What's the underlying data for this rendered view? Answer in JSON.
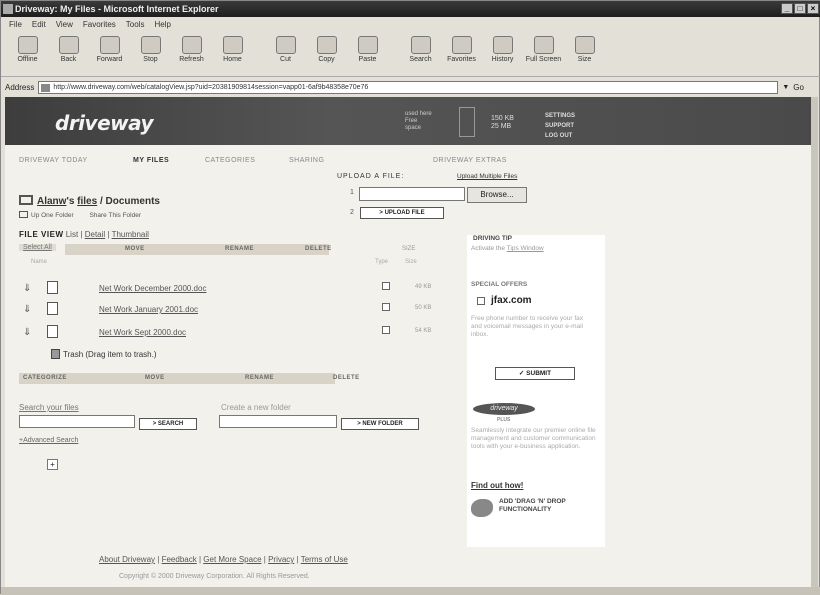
{
  "browser": {
    "title": "Driveway: My Files - Microsoft Internet Explorer",
    "menu": [
      "File",
      "Edit",
      "View",
      "Favorites",
      "Tools",
      "Help"
    ],
    "toolbar": [
      "Offline",
      "Back",
      "Forward",
      "Stop",
      "Refresh",
      "Home",
      "Cut",
      "Copy",
      "Paste",
      "Search",
      "Favorites",
      "History",
      "Full Screen",
      "Size"
    ],
    "address_label": "Address",
    "address_url": "http://www.driveway.com/web/catalogView.jsp?uid=20381909814session=vapp01-6af9b48358e70e76",
    "links_label": "Links",
    "go_label": "Go"
  },
  "header": {
    "logo": "driveway",
    "storage_lines": [
      "used here",
      "Free",
      "space"
    ],
    "used_lines": [
      "150 KB",
      "25 MB"
    ],
    "links": [
      "SETTINGS",
      "SUPPORT",
      "LOG OUT"
    ]
  },
  "nav": {
    "tabs": [
      "DRIVEWAY TODAY",
      "MY FILES",
      "CATEGORIES",
      "SHARING",
      "DRIVEWAY EXTRAS"
    ]
  },
  "upload": {
    "label": "UPLOAD A FILE:",
    "multi_link": "Upload Multiple Files",
    "row1": "1",
    "row2": "2",
    "browse": "Browse...",
    "upload_button": "> UPLOAD FILE"
  },
  "location": {
    "user": "Alanw",
    "files": "files",
    "folder": "/ Documents",
    "up_one": "Up One Folder",
    "share": "Share This Folder"
  },
  "fileview": {
    "label": "FILE VIEW",
    "modes": [
      "List",
      "Detail",
      "Thumbnail"
    ],
    "sep": "|"
  },
  "actions": {
    "select_all": "Select All",
    "categorize": "CATEGORIZE",
    "move": "MOVE",
    "rename": "RENAME",
    "delete": "DELETE",
    "size_header": "SIZE",
    "col_name": "Name",
    "col_type": "Type",
    "col_size": "Size"
  },
  "files": [
    {
      "name": "Net Work December 2000.doc",
      "size": "49 KB"
    },
    {
      "name": "Net Work January 2001.doc",
      "size": "50 KB"
    },
    {
      "name": "Net Work Sept 2000.doc",
      "size": "54 KB"
    }
  ],
  "trash": {
    "label": "Trash",
    "hint": "(Drag item to trash.)"
  },
  "search": {
    "label": "Search your files",
    "button": "> SEARCH",
    "advanced": "+Advanced Search"
  },
  "new_folder": {
    "label": "Create a new folder",
    "button": "> NEW FOLDER"
  },
  "tree_toggle": "+",
  "footer": {
    "links": [
      "About Driveway",
      "Feedback",
      "Get More Space",
      "Privacy",
      "Terms of Use"
    ],
    "sep": "|",
    "copyright": "Copyright © 2000 Driveway Corporation. All Rights Reserved."
  },
  "sidebar": {
    "tip_title": "DRIVING TIP",
    "tip_text": "Activate the",
    "tip_link": "Tips Window",
    "offers_title": "SPECIAL OFFERS",
    "offers_logo": "jfax.com",
    "offers_text": "Free phone number to receive your fax and voicemail messages in your e-mail inbox.",
    "submit": "SUBMIT",
    "badge": "driveway",
    "badge_sub": "PLUS",
    "promo_text": "Seamlessly integrate our premier online file management and customer communication tools with your e-business application.",
    "find_out": "Find out how!",
    "dnd_lines": [
      "ADD 'DRAG 'N' DROP",
      "FUNCTIONALITY"
    ]
  }
}
